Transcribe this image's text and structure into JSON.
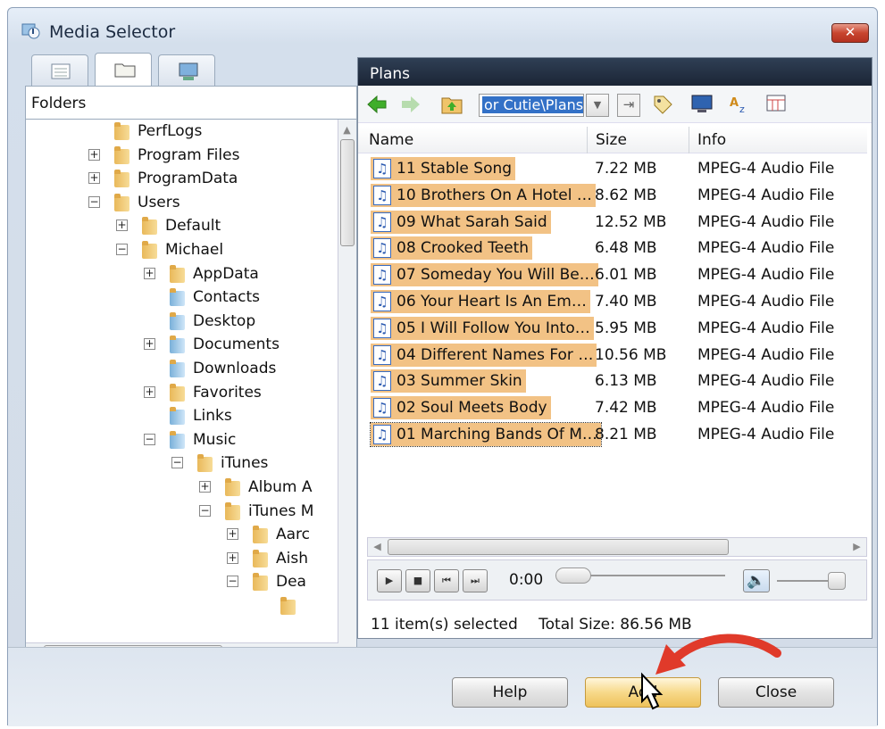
{
  "window": {
    "title": "Media Selector",
    "close_label": "✕"
  },
  "left": {
    "tabs": [
      {
        "icon": "list-view-icon"
      },
      {
        "icon": "folder-icon",
        "active": true
      },
      {
        "icon": "computer-icon"
      }
    ],
    "header": "Folders",
    "tree": [
      {
        "label": "PerfLogs",
        "indent": 0,
        "exp": ""
      },
      {
        "label": "Program Files",
        "indent": 0,
        "exp": "+"
      },
      {
        "label": "ProgramData",
        "indent": 0,
        "exp": "+"
      },
      {
        "label": "Users",
        "indent": 0,
        "exp": "−"
      },
      {
        "label": "Default",
        "indent": 1,
        "exp": "+"
      },
      {
        "label": "Michael",
        "indent": 1,
        "exp": "−"
      },
      {
        "label": "AppData",
        "indent": 2,
        "exp": "+"
      },
      {
        "label": "Contacts",
        "indent": 2,
        "exp": "",
        "blue": true
      },
      {
        "label": "Desktop",
        "indent": 2,
        "exp": "",
        "blue": true
      },
      {
        "label": "Documents",
        "indent": 2,
        "exp": "+",
        "blue": true
      },
      {
        "label": "Downloads",
        "indent": 2,
        "exp": "",
        "blue": true
      },
      {
        "label": "Favorites",
        "indent": 2,
        "exp": "+"
      },
      {
        "label": "Links",
        "indent": 2,
        "exp": "",
        "blue": true
      },
      {
        "label": "Music",
        "indent": 2,
        "exp": "−",
        "blue": true
      },
      {
        "label": "iTunes",
        "indent": 3,
        "exp": "−"
      },
      {
        "label": "Album A",
        "indent": 4,
        "exp": "+"
      },
      {
        "label": "iTunes M",
        "indent": 4,
        "exp": "−"
      },
      {
        "label": "Aarc",
        "indent": 5,
        "exp": "+"
      },
      {
        "label": "Aish",
        "indent": 5,
        "exp": "+"
      },
      {
        "label": "Dea",
        "indent": 5,
        "exp": "−"
      },
      {
        "label": "",
        "indent": 6,
        "exp": ""
      }
    ]
  },
  "right": {
    "header": "Plans",
    "path": "or Cutie\\Plans",
    "columns": {
      "name": "Name",
      "size": "Size",
      "info": "Info"
    },
    "files": [
      {
        "name": "11 Stable Song",
        "size": "7.22 MB",
        "info": "MPEG-4 Audio File"
      },
      {
        "name": "10 Brothers On A Hotel …",
        "size": "8.62 MB",
        "info": "MPEG-4 Audio File"
      },
      {
        "name": "09 What Sarah Said",
        "size": "12.52 MB",
        "info": "MPEG-4 Audio File"
      },
      {
        "name": "08 Crooked Teeth",
        "size": "6.48 MB",
        "info": "MPEG-4 Audio File"
      },
      {
        "name": "07 Someday You Will Be…",
        "size": "6.01 MB",
        "info": "MPEG-4 Audio File"
      },
      {
        "name": "06 Your Heart Is An Em…",
        "size": "7.40 MB",
        "info": "MPEG-4 Audio File"
      },
      {
        "name": "05 I Will Follow You Into…",
        "size": "5.95 MB",
        "info": "MPEG-4 Audio File"
      },
      {
        "name": "04 Different Names For …",
        "size": "10.56 MB",
        "info": "MPEG-4 Audio File"
      },
      {
        "name": "03 Summer Skin",
        "size": "6.13 MB",
        "info": "MPEG-4 Audio File"
      },
      {
        "name": "02 Soul Meets Body",
        "size": "7.42 MB",
        "info": "MPEG-4 Audio File"
      },
      {
        "name": "01 Marching Bands Of M…",
        "size": "8.21 MB",
        "info": "MPEG-4 Audio File"
      }
    ],
    "player": {
      "time": "0:00"
    },
    "status": {
      "selected": "11 item(s) selected",
      "total": "Total Size: 86.56 MB"
    }
  },
  "buttons": {
    "help": "Help",
    "add": "Add",
    "close": "Close"
  },
  "colors": {
    "selection": "#f2c285",
    "header_dark": "#1b2535",
    "arrow": "#e03a2a"
  }
}
